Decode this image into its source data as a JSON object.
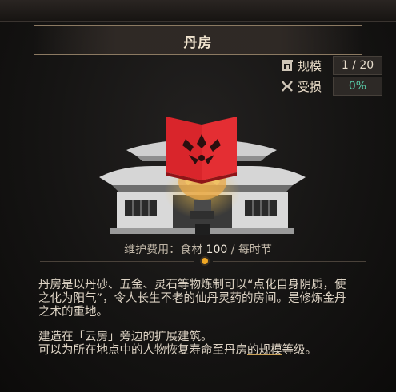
{
  "panel": {
    "title": "丹房"
  },
  "stats": {
    "scale": {
      "label": "规模",
      "value": "1 / 20",
      "icon": "scale-icon"
    },
    "damage": {
      "label": "受损",
      "value": "0%",
      "icon": "damage-icon"
    }
  },
  "maintenance": {
    "prefix": "维护费用：食材",
    "amount": "100",
    "suffix": "/ 每时节"
  },
  "description": {
    "line1": "丹房是以丹砂、五金、灵石等物炼制可以“点化自身阴质，使",
    "line2": "之化为阳气”，令人长生不老的仙丹灵药的房间。是修炼金丹",
    "line3": "之术的重地。",
    "line4": "建造在「云房」旁边的扩展建筑。",
    "line5_pre": "可以为所在地点中的人物恢复寿命至丹房",
    "line5_link": "的规模",
    "line5_post": "等级。"
  },
  "colors": {
    "accent_orange": "#f0a825",
    "damage_teal": "#58c9a6",
    "book_red": "#d9252b"
  }
}
